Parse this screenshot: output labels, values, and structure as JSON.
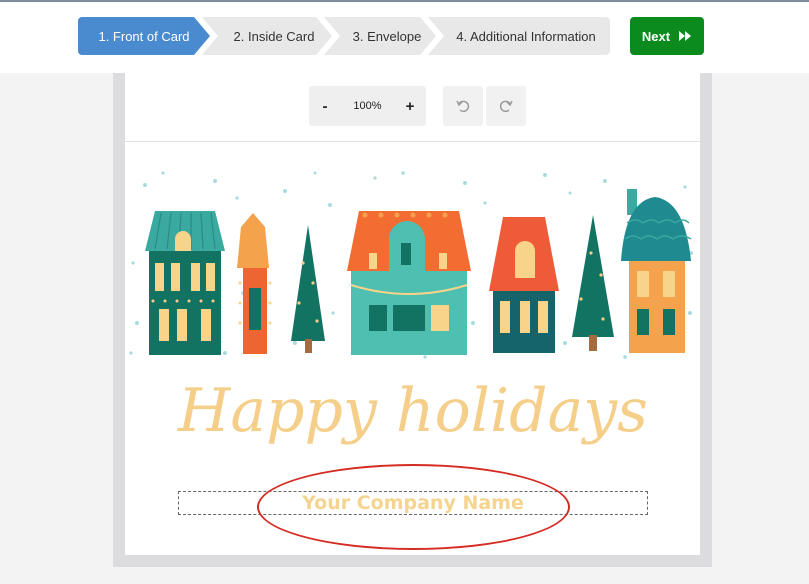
{
  "wizard": {
    "steps": [
      {
        "label": "1. Front of Card",
        "active": true
      },
      {
        "label": "2. Inside Card",
        "active": false
      },
      {
        "label": "3. Envelope",
        "active": false
      },
      {
        "label": "4. Additional Information",
        "active": false
      }
    ],
    "next_label": "Next",
    "next_icon": "fast-forward-icon"
  },
  "toolbar": {
    "zoom_out": "-",
    "zoom_value": "100%",
    "zoom_in": "+",
    "undo_icon": "undo-icon",
    "redo_icon": "redo-icon"
  },
  "card": {
    "greeting": "Happy holidays",
    "company_placeholder": "Your Company Name"
  },
  "colors": {
    "active_step": "#4a8bd0",
    "next_button": "#0b8a1e",
    "script_text": "#f5cf8a",
    "annotation": "#d62b22"
  }
}
